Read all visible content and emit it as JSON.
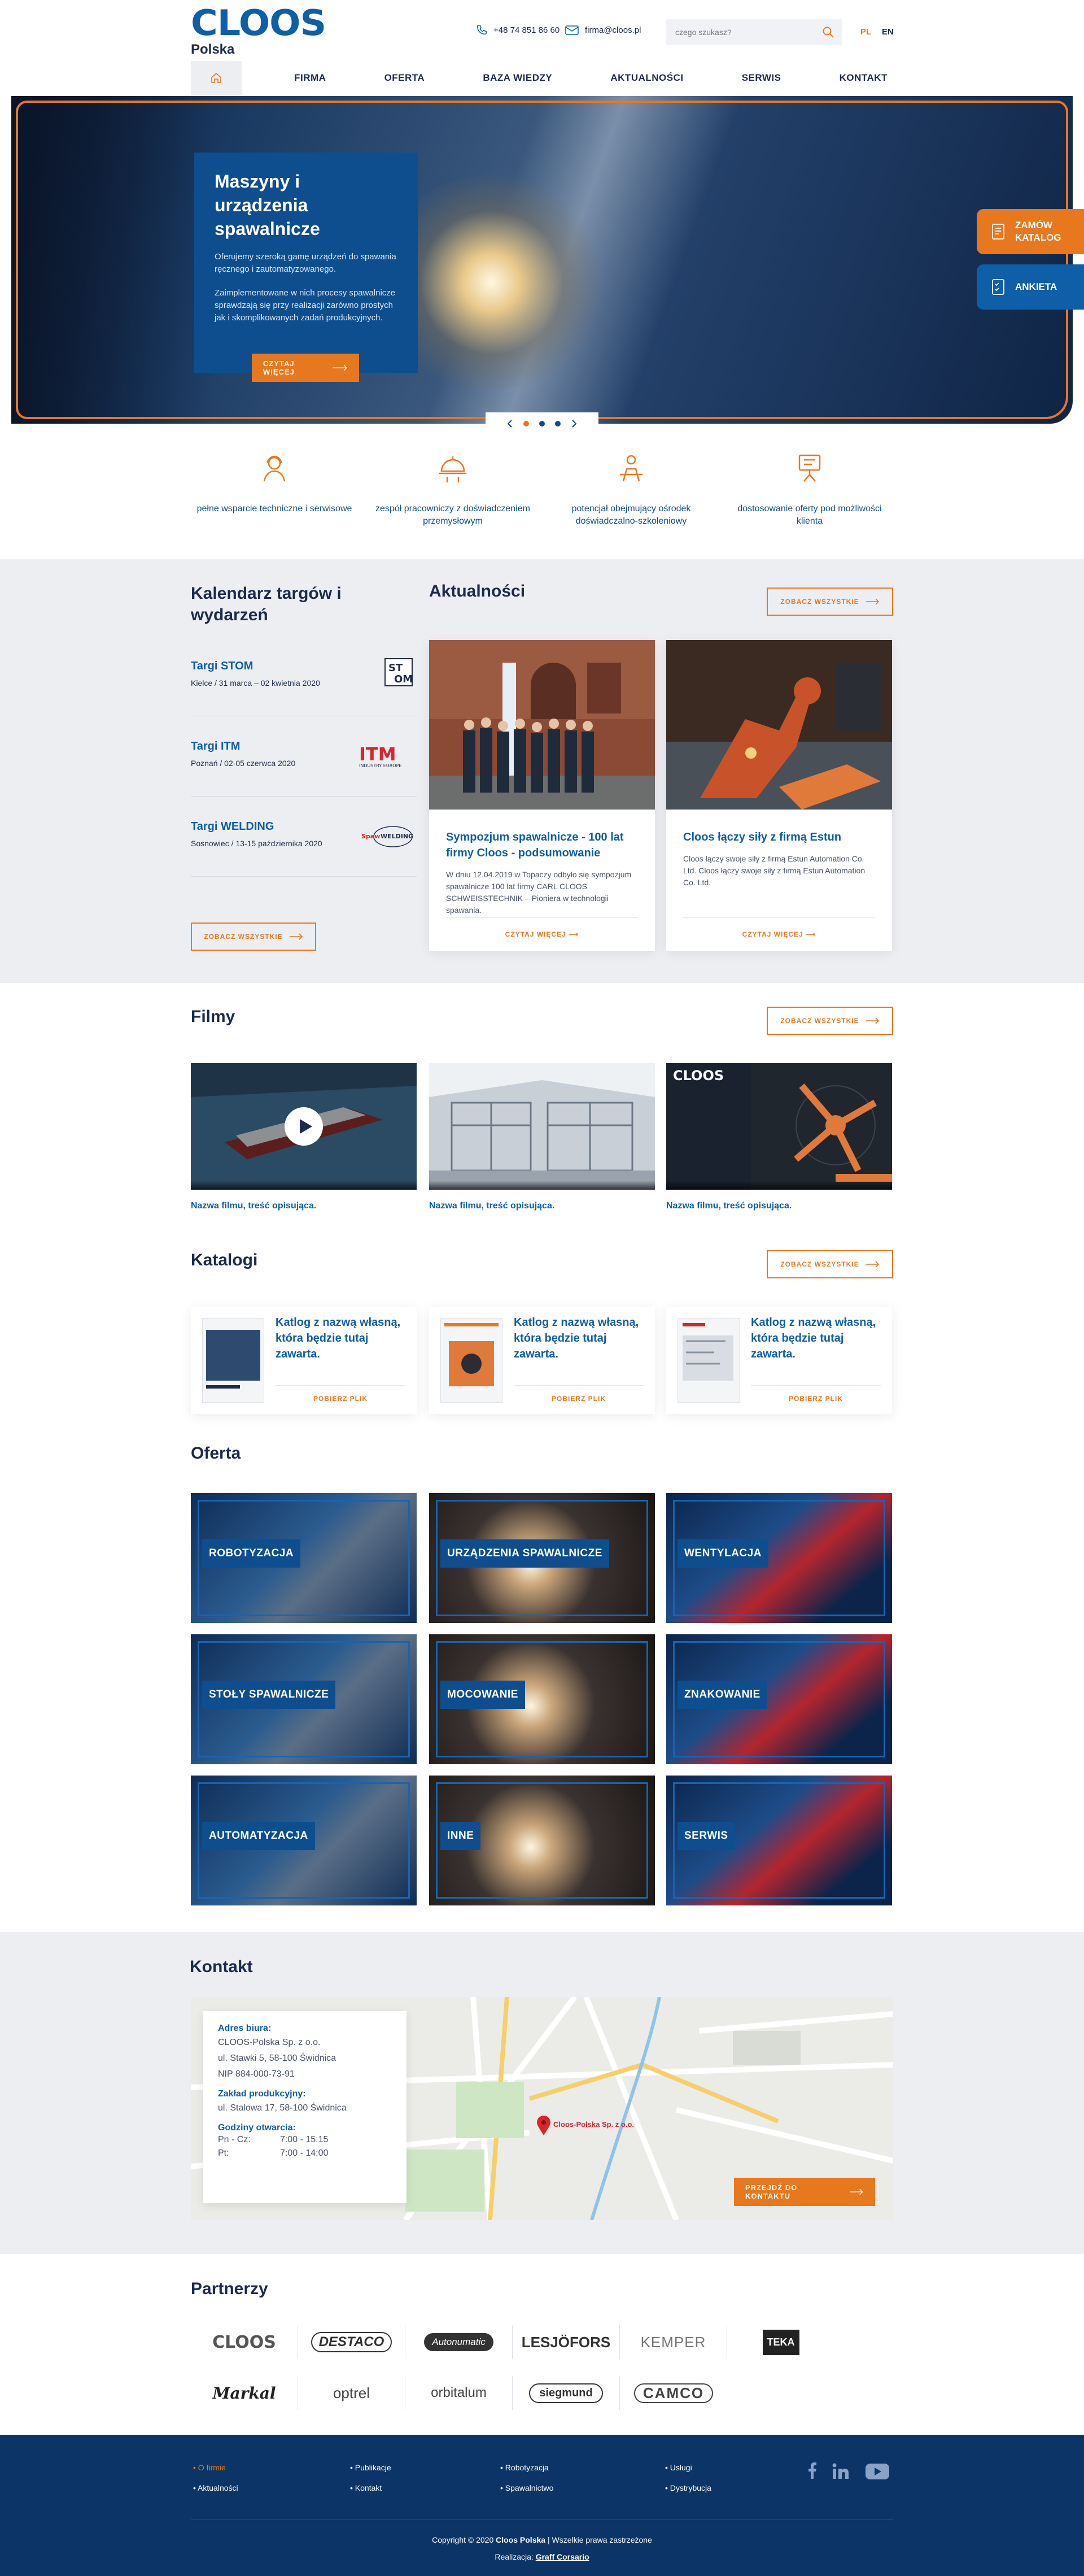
{
  "header": {
    "logo": "CLOOS",
    "logo_sub": "Polska",
    "phone": "+48 74 851 86 60",
    "email": "firma@cloos.pl",
    "search_placeholder": "czego szukasz?",
    "lang_pl": "PL",
    "lang_en": "EN"
  },
  "nav": {
    "items": [
      "FIRMA",
      "OFERTA",
      "BAZA WIEDZY",
      "AKTUALNOŚCI",
      "SERWIS",
      "KONTAKT"
    ]
  },
  "hero": {
    "title": "Maszyny i urządzenia spawalnicze",
    "p1": "Oferujemy szeroką gamę urządzeń do spawania ręcznego i zautomatyzowanego.",
    "p2": "Zaimplementowane w nich procesy spawalnicze sprawdzają się przy realizacji zarówno prostych jak i skomplikowanych zadań produkcyjnych.",
    "button": "CZYTAJ WIĘCEJ",
    "side_order": "ZAMÓW KATALOG",
    "side_survey": "ANKIETA",
    "slide_active": 1,
    "slide_count": 3
  },
  "features": [
    {
      "icon": "support-icon",
      "text": "pełne wsparcie techniczne i serwisowe"
    },
    {
      "icon": "team-icon",
      "text": "zespół pracowniczy z doświadczeniem przemysłowym"
    },
    {
      "icon": "training-icon",
      "text": "potencjał obejmujący ośrodek doświadczalno-szkoleniowy"
    },
    {
      "icon": "offer-icon",
      "text": "dostosowanie oferty pod możliwości klienta"
    }
  ],
  "events": {
    "title": "Kalendarz targów i wydarzeń",
    "items": [
      {
        "title": "Targi STOM",
        "details": "Kielce / 31 marca – 02 kwietnia 2020",
        "logo": "STOM"
      },
      {
        "title": "Targi ITM",
        "details": "Poznań / 02-05 czerwca 2020",
        "logo": "ITM"
      },
      {
        "title": "Targi WELDING",
        "details": "Sosnowiec / 13-15 października 2020",
        "logo": "WELDING"
      }
    ],
    "button": "ZOBACZ WSZYSTKIE"
  },
  "news": {
    "title": "Aktualności",
    "button": "ZOBACZ WSZYSTKIE",
    "items": [
      {
        "title": "Sympozjum spawalnicze - 100 lat firmy Cloos - podsumowanie",
        "text": "W dniu 12.04.2019 w Topaczy odbyło się sympozjum spawalnicze 100 lat firmy  CARL CLOOS SCHWEISSTECHNIK – Pioniera w technologii spawania.",
        "more": "CZYTAJ WIĘCEJ"
      },
      {
        "title": "Cloos łączy siły z firmą Estun",
        "text": "Cloos łączy swoje siły z firmą Estun Automation Co. Ltd.  Cloos łączy swoje siły z firmą Estun Automation Co. Ltd.",
        "more": "CZYTAJ WIĘCEJ"
      }
    ]
  },
  "films": {
    "title": "Filmy",
    "button": "ZOBACZ WSZYSTKIE",
    "items": [
      {
        "caption": "Nazwa filmu, treść opisująca."
      },
      {
        "caption": "Nazwa filmu, treść opisująca."
      },
      {
        "caption": "Nazwa filmu, treść opisująca."
      }
    ]
  },
  "catalogs": {
    "title": "Katalogi",
    "button": "ZOBACZ WSZYSTKIE",
    "items": [
      {
        "title": "Katlog z nazwą własną, która będzie tutaj zawarta.",
        "download": "POBIERZ PLIK"
      },
      {
        "title": "Katlog z nazwą własną, która będzie tutaj zawarta.",
        "download": "POBIERZ PLIK"
      },
      {
        "title": "Katlog z nazwą własną, która będzie tutaj zawarta.",
        "download": "POBIERZ PLIK"
      }
    ]
  },
  "offer": {
    "title": "Oferta",
    "items": [
      "ROBOTYZACJA",
      "URZĄDZENIA SPAWALNICZE",
      "WENTYLACJA",
      "STOŁY SPAWALNICZE",
      "MOCOWANIE",
      "ZNAKOWANIE",
      "AUTOMATYZACJA",
      "INNE",
      "SERWIS"
    ]
  },
  "contact": {
    "title": "Kontakt",
    "office_h": "Adres biura:",
    "office_1": "CLOOS-Polska Sp. z o.o.",
    "office_2": "ul. Stawki 5, 58-100 Świdnica",
    "office_3": "NIP  884-000-73-91",
    "plant_h": "Zakład produkcyjny:",
    "plant_1": "ul. Stalowa 17, 58-100 Świdnica",
    "hours_h": "Godziny otwarcia:",
    "hours_1_d": "Pn - Cz:",
    "hours_1_t": "7:00 - 15:15",
    "hours_2_d": "Pt:",
    "hours_2_t": "7:00 - 14:00",
    "map_pin": "Cloos-Polska Sp. z o.o.",
    "button": "PRZEJDŹ DO KONTAKTU"
  },
  "partners": {
    "title": "Partnerzy",
    "items": [
      "CLOOS",
      "DESTACO",
      "Autonumatic",
      "LESJÖFORS",
      "KEMPER",
      "TEKA",
      "Markal",
      "optrel",
      "orbitalum",
      "siegmund",
      "CAMCO"
    ]
  },
  "footer": {
    "col1": [
      "O firmie",
      "Aktualności"
    ],
    "col2": [
      "Publikacje",
      "Kontakt"
    ],
    "col3": [
      "Robotyzacja",
      "Spawalnictwo"
    ],
    "col4": [
      "Usługi",
      "Dystrybucja"
    ],
    "copyright_a": "Copyright © 2020 ",
    "copyright_b": "Cloos Polska",
    "copyright_c": "  |  Wszelkie prawa zastrzeżone",
    "credit_a": "Realizacja: ",
    "credit_b": "Graff Corsario"
  },
  "colors": {
    "brand_blue": "#0f4e8e",
    "accent_orange": "#e8781e",
    "footer_blue": "#0d3466"
  }
}
